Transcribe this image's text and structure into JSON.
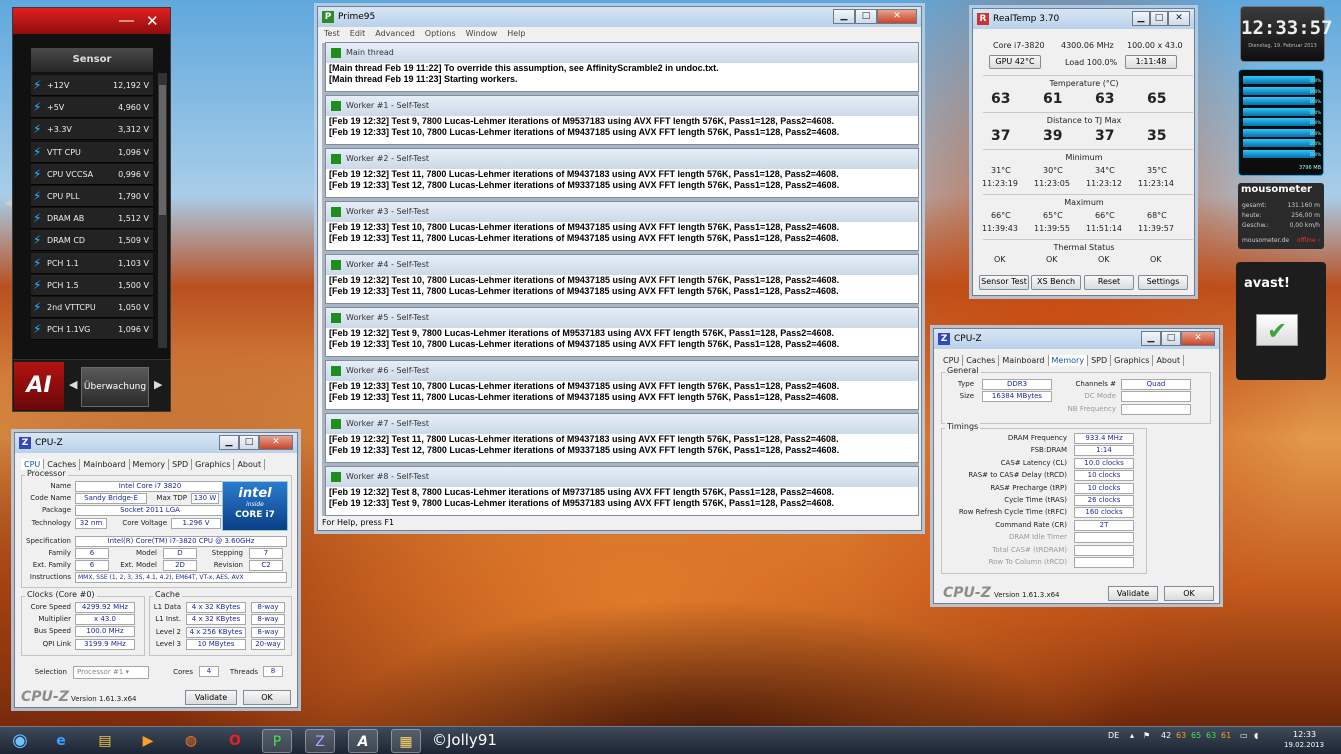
{
  "sensor_gadget": {
    "header": "Sensor",
    "rows": [
      {
        "name": "+12V",
        "value": "12,192",
        "unit": "V"
      },
      {
        "name": "+5V",
        "value": "4,960",
        "unit": "V"
      },
      {
        "name": "+3.3V",
        "value": "3,312",
        "unit": "V"
      },
      {
        "name": "VTT CPU",
        "value": "1,096",
        "unit": "V"
      },
      {
        "name": "CPU VCCSA",
        "value": "0,996",
        "unit": "V"
      },
      {
        "name": "CPU PLL",
        "value": "1,790",
        "unit": "V"
      },
      {
        "name": "DRAM AB",
        "value": "1,512",
        "unit": "V"
      },
      {
        "name": "DRAM CD",
        "value": "1,509",
        "unit": "V"
      },
      {
        "name": "PCH 1.1",
        "value": "1,103",
        "unit": "V"
      },
      {
        "name": "PCH 1.5",
        "value": "1,500",
        "unit": "V"
      },
      {
        "name": "2nd VTTCPU",
        "value": "1,050",
        "unit": "V"
      },
      {
        "name": "PCH 1.1VG",
        "value": "1,096",
        "unit": "V"
      }
    ],
    "logo_text": "AI",
    "monitor_button": "Überwachung"
  },
  "prime95": {
    "title": "Prime95",
    "menu": [
      "Test",
      "Edit",
      "Advanced",
      "Options",
      "Window",
      "Help"
    ],
    "status": "For Help, press F1",
    "threads": [
      {
        "title": "Main thread",
        "lines": [
          "[Main thread Feb 19 11:22] To override this assumption, see AffinityScramble2 in undoc.txt.",
          "[Main thread Feb 19 11:23] Starting workers."
        ]
      },
      {
        "title": "Worker #1 - Self-Test",
        "lines": [
          "[Feb 19 12:32] Test 9, 7800 Lucas-Lehmer iterations of M9537183 using AVX FFT length 576K, Pass1=128, Pass2=4608.",
          "[Feb 19 12:33] Test 10, 7800 Lucas-Lehmer iterations of M9437185 using AVX FFT length 576K, Pass1=128, Pass2=4608."
        ]
      },
      {
        "title": "Worker #2 - Self-Test",
        "lines": [
          "[Feb 19 12:32] Test 11, 7800 Lucas-Lehmer iterations of M9437183 using AVX FFT length 576K, Pass1=128, Pass2=4608.",
          "[Feb 19 12:33] Test 12, 7800 Lucas-Lehmer iterations of M9337185 using AVX FFT length 576K, Pass1=128, Pass2=4608."
        ]
      },
      {
        "title": "Worker #3 - Self-Test",
        "lines": [
          "[Feb 19 12:33] Test 10, 7800 Lucas-Lehmer iterations of M9437185 using AVX FFT length 576K, Pass1=128, Pass2=4608.",
          "[Feb 19 12:33] Test 11, 7800 Lucas-Lehmer iterations of M9437185 using AVX FFT length 576K, Pass1=128, Pass2=4608."
        ]
      },
      {
        "title": "Worker #4 - Self-Test",
        "lines": [
          "[Feb 19 12:32] Test 10, 7800 Lucas-Lehmer iterations of M9437185 using AVX FFT length 576K, Pass1=128, Pass2=4608.",
          "[Feb 19 12:33] Test 11, 7800 Lucas-Lehmer iterations of M9437185 using AVX FFT length 576K, Pass1=128, Pass2=4608."
        ]
      },
      {
        "title": "Worker #5 - Self-Test",
        "lines": [
          "[Feb 19 12:32] Test 9, 7800 Lucas-Lehmer iterations of M9537183 using AVX FFT length 576K, Pass1=128, Pass2=4608.",
          "[Feb 19 12:33] Test 10, 7800 Lucas-Lehmer iterations of M9437185 using AVX FFT length 576K, Pass1=128, Pass2=4608."
        ]
      },
      {
        "title": "Worker #6 - Self-Test",
        "lines": [
          "[Feb 19 12:33] Test 10, 7800 Lucas-Lehmer iterations of M9437185 using AVX FFT length 576K, Pass1=128, Pass2=4608.",
          "[Feb 19 12:33] Test 11, 7800 Lucas-Lehmer iterations of M9437185 using AVX FFT length 576K, Pass1=128, Pass2=4608."
        ]
      },
      {
        "title": "Worker #7 - Self-Test",
        "lines": [
          "[Feb 19 12:32] Test 11, 7800 Lucas-Lehmer iterations of M9437183 using AVX FFT length 576K, Pass1=128, Pass2=4608.",
          "[Feb 19 12:33] Test 12, 7800 Lucas-Lehmer iterations of M9337185 using AVX FFT length 576K, Pass1=128, Pass2=4608."
        ]
      },
      {
        "title": "Worker #8 - Self-Test",
        "lines": [
          "[Feb 19 12:32] Test 8, 7800 Lucas-Lehmer iterations of M9737185 using AVX FFT length 576K, Pass1=128, Pass2=4608.",
          "[Feb 19 12:33] Test 9, 7800 Lucas-Lehmer iterations of M9537183 using AVX FFT length 576K, Pass1=128, Pass2=4608."
        ]
      }
    ]
  },
  "realtemp": {
    "title": "RealTemp 3.70",
    "cpu": "Core i7-3820",
    "freq": "4300.06 MHz",
    "mult": "100.00 x 43.0",
    "gpu_button": "GPU  42°C",
    "load": "Load 100.0%",
    "time_button": "1:11:48",
    "temp_label": "Temperature (°C)",
    "temps": [
      "63",
      "61",
      "63",
      "65"
    ],
    "dist_label": "Distance to TJ Max",
    "dists": [
      "37",
      "39",
      "37",
      "35"
    ],
    "min_label": "Minimum",
    "mins": [
      "31°C",
      "30°C",
      "34°C",
      "35°C"
    ],
    "min_times": [
      "11:23:19",
      "11:23:05",
      "11:23:12",
      "11:23:14"
    ],
    "max_label": "Maximum",
    "maxs": [
      "66°C",
      "65°C",
      "66°C",
      "68°C"
    ],
    "max_times": [
      "11:39:43",
      "11:39:55",
      "11:51:14",
      "11:39:57"
    ],
    "thermal_label": "Thermal Status",
    "status": [
      "OK",
      "OK",
      "OK",
      "OK"
    ],
    "buttons": [
      "Sensor Test",
      "XS Bench",
      "Reset",
      "Settings"
    ]
  },
  "cpuz_mem": {
    "title": "CPU-Z",
    "tabs": [
      "CPU",
      "Caches",
      "Mainboard",
      "Memory",
      "SPD",
      "Graphics",
      "About"
    ],
    "general_legend": "General",
    "type_label": "Type",
    "type": "DDR3",
    "size_label": "Size",
    "size": "16384 MBytes",
    "channels_label": "Channels #",
    "channels": "Quad",
    "dc_mode_label": "DC Mode",
    "nb_freq_label": "NB Frequency",
    "timings_legend": "Timings",
    "timings": [
      {
        "label": "DRAM Frequency",
        "value": "933.4 MHz",
        "dim": false
      },
      {
        "label": "FSB:DRAM",
        "value": "1:14",
        "dim": false
      },
      {
        "label": "CAS# Latency (CL)",
        "value": "10.0 clocks",
        "dim": false
      },
      {
        "label": "RAS# to CAS# Delay (tRCD)",
        "value": "10 clocks",
        "dim": false
      },
      {
        "label": "RAS# Precharge (tRP)",
        "value": "10 clocks",
        "dim": false
      },
      {
        "label": "Cycle Time (tRAS)",
        "value": "26 clocks",
        "dim": false
      },
      {
        "label": "Row Refresh Cycle Time (tRFC)",
        "value": "160 clocks",
        "dim": false
      },
      {
        "label": "Command Rate (CR)",
        "value": "2T",
        "dim": false
      },
      {
        "label": "DRAM Idle Timer",
        "value": "",
        "dim": true
      },
      {
        "label": "Total CAS# (tRDRAM)",
        "value": "",
        "dim": true
      },
      {
        "label": "Row To Column (tRCD)",
        "value": "",
        "dim": true
      }
    ],
    "brand": "CPU-Z",
    "version": "Version 1.61.3.x64",
    "validate": "Validate",
    "ok": "OK"
  },
  "cpuz_cpu": {
    "title": "CPU-Z",
    "tabs": [
      "CPU",
      "Caches",
      "Mainboard",
      "Memory",
      "SPD",
      "Graphics",
      "About"
    ],
    "processor_legend": "Processor",
    "name_label": "Name",
    "name": "Intel Core i7 3820",
    "codename_label": "Code Name",
    "codename": "Sandy Bridge-E",
    "maxtdp_label": "Max TDP",
    "maxtdp": "130 W",
    "package_label": "Package",
    "package": "Socket 2011 LGA",
    "tech_label": "Technology",
    "tech": "32 nm",
    "voltage_label": "Core Voltage",
    "voltage": "1.296 V",
    "spec_label": "Specification",
    "spec": "Intel(R) Core(TM) i7-3820 CPU @ 3.60GHz",
    "family_label": "Family",
    "family": "6",
    "model_label": "Model",
    "model": "D",
    "stepping_label": "Stepping",
    "stepping": "7",
    "extfamily_label": "Ext. Family",
    "extfamily": "6",
    "extmodel_label": "Ext. Model",
    "extmodel": "2D",
    "revision_label": "Revision",
    "revision": "C2",
    "instr_label": "Instructions",
    "instr": "MMX, SSE (1, 2, 3, 3S, 4.1, 4.2), EM64T, VT-x, AES, AVX",
    "intel_logo": "intel",
    "intel_inside": "inside",
    "intel_core": "CORE i7",
    "clocks_legend": "Clocks (Core #0)",
    "corespeed_label": "Core Speed",
    "corespeed": "4299.92 MHz",
    "multiplier_label": "Multiplier",
    "multiplier": "x 43.0",
    "busspeed_label": "Bus Speed",
    "busspeed": "100.0 MHz",
    "qpi_label": "QPI Link",
    "qpi": "3199.9 MHz",
    "cache_legend": "Cache",
    "caches": [
      {
        "label": "L1 Data",
        "size": "4 x 32 KBytes",
        "way": "8-way"
      },
      {
        "label": "L1 Inst.",
        "size": "4 x 32 KBytes",
        "way": "8-way"
      },
      {
        "label": "Level 2",
        "size": "4 x 256 KBytes",
        "way": "8-way"
      },
      {
        "label": "Level 3",
        "size": "10 MBytes",
        "way": "20-way"
      }
    ],
    "selection_label": "Selection",
    "selection": "Processor #1",
    "cores_label": "Cores",
    "cores": "4",
    "threads_label": "Threads",
    "threads": "8",
    "brand": "CPU-Z",
    "version": "Version 1.61.3.x64",
    "validate": "Validate",
    "ok": "OK"
  },
  "clock_gadget": {
    "time": "12:33:57",
    "date": "Dienstag, 19. Februar 2013"
  },
  "mem_gadget": {
    "bar_pct": [
      "100%",
      "100%",
      "100%",
      "100%",
      "100%",
      "100%",
      "100%",
      "100%"
    ],
    "total": "3796 MB"
  },
  "mouse_gadget": {
    "title": "mousometer",
    "rows": [
      {
        "label": "gesamt:",
        "value": "131.160 m"
      },
      {
        "label": "heute:",
        "value": "256,00 m"
      },
      {
        "label": "Geschw.:",
        "value": "0,00 km/h"
      }
    ],
    "site": "mousometer.de",
    "status": "offline ›"
  },
  "avast_gadget": {
    "logo": "avast!"
  },
  "taskbar": {
    "watermark": "©Jolly91",
    "lang": "DE",
    "temps": [
      "42",
      "63",
      "65",
      "63",
      "61"
    ],
    "time": "12:33",
    "date": "19.02.2013"
  }
}
